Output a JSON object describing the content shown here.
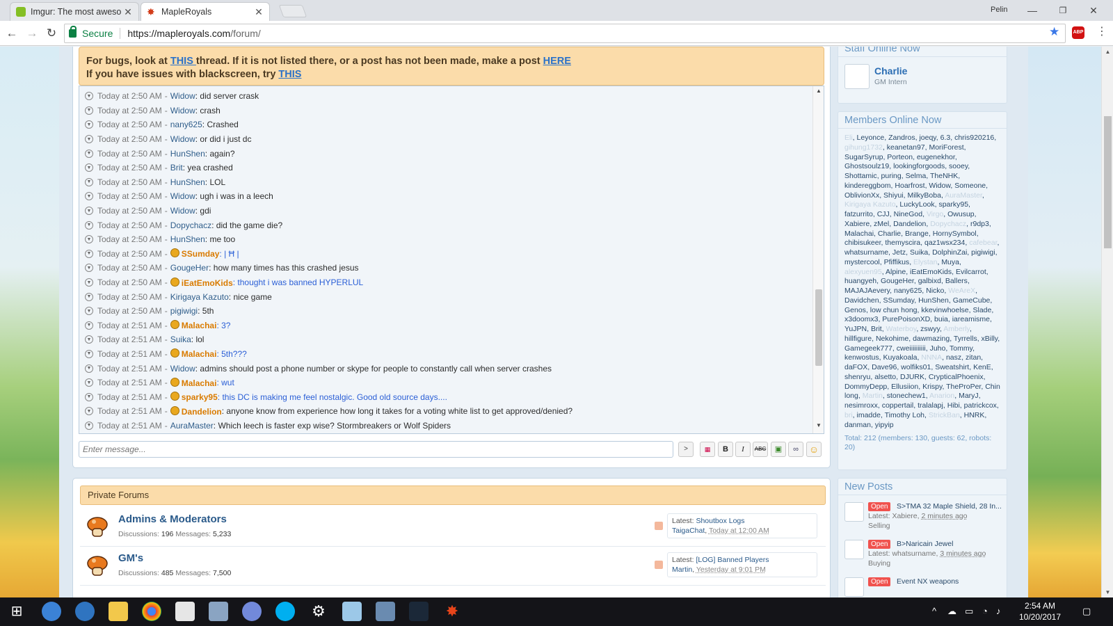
{
  "browser": {
    "tabs": [
      {
        "title": "Imgur: The most aweso",
        "active": false
      },
      {
        "title": "MapleRoyals",
        "active": true
      }
    ],
    "profile_name": "Pelin",
    "secure_label": "Secure",
    "url_host": "https://mapleroyals.com",
    "url_path": "/forum/",
    "abp_label": "ABP"
  },
  "notice": {
    "line1_prefix": "For bugs, look at ",
    "line1_link1": "THIS ",
    "line1_middle": "thread. If it is not listed there, or a post has not been made, make a post ",
    "line1_link2": "HERE",
    "line2_prefix": "If you have issues with blackscreen, try ",
    "line2_link": "THIS"
  },
  "shoutbox": {
    "messages": [
      {
        "time": "Today at 2:50 AM",
        "user": "Widow",
        "text": "did server crask",
        "staff": false,
        "blue": false
      },
      {
        "time": "Today at 2:50 AM",
        "user": "Widow",
        "text": "crash",
        "staff": false,
        "blue": false
      },
      {
        "time": "Today at 2:50 AM",
        "user": "nany625",
        "text": "Crashed",
        "staff": false,
        "blue": false
      },
      {
        "time": "Today at 2:50 AM",
        "user": "Widow",
        "text": "or did i just dc",
        "staff": false,
        "blue": false
      },
      {
        "time": "Today at 2:50 AM",
        "user": "HunShen",
        "text": "again?",
        "staff": false,
        "blue": false
      },
      {
        "time": "Today at 2:50 AM",
        "user": "Brit",
        "text": "yea crashed",
        "staff": false,
        "blue": false
      },
      {
        "time": "Today at 2:50 AM",
        "user": "HunShen",
        "text": "LOL",
        "staff": false,
        "blue": false
      },
      {
        "time": "Today at 2:50 AM",
        "user": "Widow",
        "text": "ugh i was in a leech",
        "staff": false,
        "blue": false
      },
      {
        "time": "Today at 2:50 AM",
        "user": "Widow",
        "text": "gdi",
        "staff": false,
        "blue": false
      },
      {
        "time": "Today at 2:50 AM",
        "user": "Dopychacz",
        "text": "did the game die?",
        "staff": false,
        "blue": false
      },
      {
        "time": "Today at 2:50 AM",
        "user": "HunShen",
        "text": "me too",
        "staff": false,
        "blue": false
      },
      {
        "time": "Today at 2:50 AM",
        "user": "SSumday",
        "text": "| Ħ |",
        "staff": true,
        "blue": true
      },
      {
        "time": "Today at 2:50 AM",
        "user": "GougeHer",
        "text": "how many times has this crashed jesus",
        "staff": false,
        "blue": false
      },
      {
        "time": "Today at 2:50 AM",
        "user": "iEatEmoKids",
        "text": "thought i was banned HYPERLUL",
        "staff": true,
        "blue": true
      },
      {
        "time": "Today at 2:50 AM",
        "user": "Kirigaya Kazuto",
        "text": "nice game",
        "staff": false,
        "blue": false
      },
      {
        "time": "Today at 2:50 AM",
        "user": "pigiwigi",
        "text": "5th",
        "staff": false,
        "blue": false
      },
      {
        "time": "Today at 2:51 AM",
        "user": "Malachai",
        "text": "3?",
        "staff": true,
        "blue": true
      },
      {
        "time": "Today at 2:51 AM",
        "user": "Suika",
        "text": "lol",
        "staff": false,
        "blue": false
      },
      {
        "time": "Today at 2:51 AM",
        "user": "Malachai",
        "text": "5th???",
        "staff": true,
        "blue": true
      },
      {
        "time": "Today at 2:51 AM",
        "user": "Widow",
        "text": "admins should post a phone number or skype for people to constantly call when server crashes",
        "staff": false,
        "blue": false
      },
      {
        "time": "Today at 2:51 AM",
        "user": "Malachai",
        "text": "wut",
        "staff": true,
        "blue": true
      },
      {
        "time": "Today at 2:51 AM",
        "user": "sparky95",
        "text": "this DC is making me feel nostalgic. Good old source days....",
        "staff": true,
        "blue": true
      },
      {
        "time": "Today at 2:51 AM",
        "user": "Dandelion",
        "text": "anyone know from experience how long it takes for a voting white list to get approved/denied?",
        "staff": true,
        "blue": false
      },
      {
        "time": "Today at 2:51 AM",
        "user": "AuraMaster",
        "text": "Which leech is faster exp wise? Stormbreakers or Wolf Spiders",
        "staff": false,
        "blue": false
      }
    ],
    "input_placeholder": "Enter message...",
    "send_label": ">",
    "format_buttons": [
      "B",
      "I",
      "ABC"
    ]
  },
  "private_forums": {
    "heading": "Private Forums",
    "forums": [
      {
        "title": "Admins & Moderators",
        "discussions_label": "Discussions:",
        "discussions": "196",
        "messages_label": "Messages:",
        "messages": "5,233",
        "latest_label": "Latest:",
        "latest_title": "Shoutbox Logs",
        "latest_user": "TaigaChat",
        "latest_time": "Today at 12:00 AM"
      },
      {
        "title": "GM's",
        "discussions_label": "Discussions:",
        "discussions": "485",
        "messages_label": "Messages:",
        "messages": "7,500",
        "latest_label": "Latest:",
        "latest_title": "[LOG] Banned Players",
        "latest_user": "Martin",
        "latest_time": "Yesterday at 9:01 PM"
      }
    ]
  },
  "sidebar": {
    "staff_title": "Staff Online Now",
    "staff_name": "Charlie",
    "staff_role": "GM Intern",
    "members_title": "Members Online Now",
    "members": [
      {
        "n": "Eli",
        "d": true
      },
      {
        "n": "Leyonce",
        "d": false
      },
      {
        "n": "Zandros",
        "d": false
      },
      {
        "n": "joeqy",
        "d": false
      },
      {
        "n": "6.3",
        "d": false
      },
      {
        "n": "chris920216",
        "d": false
      },
      {
        "n": "gihung1732",
        "d": true
      },
      {
        "n": "keanetan97",
        "d": false
      },
      {
        "n": "MoriForest",
        "d": false
      },
      {
        "n": "SugarSyrup",
        "d": false
      },
      {
        "n": "Porteon",
        "d": false
      },
      {
        "n": "eugenekhor",
        "d": false
      },
      {
        "n": "Ghostsoulz19",
        "d": false
      },
      {
        "n": "lookingforgoods",
        "d": false
      },
      {
        "n": "sooey",
        "d": false
      },
      {
        "n": "Shottamic",
        "d": false
      },
      {
        "n": "puring",
        "d": false
      },
      {
        "n": "Selma",
        "d": false
      },
      {
        "n": "TheNHK",
        "d": false
      },
      {
        "n": "kindereggbom",
        "d": false
      },
      {
        "n": "Hoarfrost",
        "d": false
      },
      {
        "n": "Widow",
        "d": false
      },
      {
        "n": "Someone",
        "d": false
      },
      {
        "n": "OblivionXx",
        "d": false
      },
      {
        "n": "Shiyui",
        "d": false
      },
      {
        "n": "MilkyBoba",
        "d": false
      },
      {
        "n": "AuraMaster",
        "d": true
      },
      {
        "n": "Kirigaya Kazuto",
        "d": true
      },
      {
        "n": "LuckyLook",
        "d": false
      },
      {
        "n": "sparky95",
        "d": false
      },
      {
        "n": "fatzurrito",
        "d": false
      },
      {
        "n": "CJJ",
        "d": false
      },
      {
        "n": "NineGod",
        "d": false
      },
      {
        "n": "Virgo",
        "d": true
      },
      {
        "n": "Owusup",
        "d": false
      },
      {
        "n": "Xabiere",
        "d": false
      },
      {
        "n": "zMel",
        "d": false
      },
      {
        "n": "Dandelion",
        "d": false
      },
      {
        "n": "Dopychacz",
        "d": true
      },
      {
        "n": "r9dp3",
        "d": false
      },
      {
        "n": "Malachai",
        "d": false
      },
      {
        "n": "Charlie",
        "d": false
      },
      {
        "n": "Brange",
        "d": false
      },
      {
        "n": "HornySymbol",
        "d": false
      },
      {
        "n": "chibisukeer",
        "d": false
      },
      {
        "n": "themyscira",
        "d": false
      },
      {
        "n": "qaz1wsx234",
        "d": false
      },
      {
        "n": "cafebear",
        "d": true
      },
      {
        "n": "whatsurname",
        "d": false
      },
      {
        "n": "Jetz",
        "d": false
      },
      {
        "n": "Suika",
        "d": false
      },
      {
        "n": "DolphinZai",
        "d": false
      },
      {
        "n": "pigiwigi",
        "d": false
      },
      {
        "n": "mystercool",
        "d": false
      },
      {
        "n": "Pfiffikus",
        "d": false
      },
      {
        "n": "Elystan",
        "d": true
      },
      {
        "n": "Muya",
        "d": false
      },
      {
        "n": "alexyuen95",
        "d": true
      },
      {
        "n": "Alpine",
        "d": false
      },
      {
        "n": "iEatEmoKids",
        "d": false
      },
      {
        "n": "Evilcarrot",
        "d": false
      },
      {
        "n": "huangyeh",
        "d": false
      },
      {
        "n": "GougeHer",
        "d": false
      },
      {
        "n": "galbixd",
        "d": false
      },
      {
        "n": "Ballers",
        "d": false
      },
      {
        "n": "MAJAJAevery",
        "d": false
      },
      {
        "n": "nany625",
        "d": false
      },
      {
        "n": "Nicko",
        "d": false
      },
      {
        "n": "WeAreX",
        "d": true
      },
      {
        "n": "Davidchen",
        "d": false
      },
      {
        "n": "SSumday",
        "d": false
      },
      {
        "n": "HunShen",
        "d": false
      },
      {
        "n": "GameCube",
        "d": false
      },
      {
        "n": "Genos",
        "d": false
      },
      {
        "n": "low chun hong",
        "d": false
      },
      {
        "n": "kkevinwhoelse",
        "d": false
      },
      {
        "n": "Slade",
        "d": false
      },
      {
        "n": "x3doomx3",
        "d": false
      },
      {
        "n": "PurePoisonXD",
        "d": false
      },
      {
        "n": "buia",
        "d": false
      },
      {
        "n": "iareamisme",
        "d": false
      },
      {
        "n": "YuJPN",
        "d": false
      },
      {
        "n": "Brit",
        "d": false
      },
      {
        "n": "Waterboy",
        "d": true
      },
      {
        "n": "zswyy",
        "d": false
      },
      {
        "n": "Amberly",
        "d": true
      },
      {
        "n": "hillfigure",
        "d": false
      },
      {
        "n": "Nekohime",
        "d": false
      },
      {
        "n": "dawmazing",
        "d": false
      },
      {
        "n": "Tyrrells",
        "d": false
      },
      {
        "n": "xBilly",
        "d": false
      },
      {
        "n": "Gamegeek777",
        "d": false
      },
      {
        "n": "cweiiiiiiiiii",
        "d": false
      },
      {
        "n": "Juho",
        "d": false
      },
      {
        "n": "Tommy",
        "d": false
      },
      {
        "n": "kenwostus",
        "d": false
      },
      {
        "n": "Kuyakoala",
        "d": false
      },
      {
        "n": "NNNA",
        "d": true
      },
      {
        "n": "nasz",
        "d": false
      },
      {
        "n": "zitan",
        "d": false
      },
      {
        "n": "daFOX",
        "d": false
      },
      {
        "n": "Dave96",
        "d": false
      },
      {
        "n": "wolfiks01",
        "d": false
      },
      {
        "n": "Sweatshirt",
        "d": false
      },
      {
        "n": "KenE",
        "d": false
      },
      {
        "n": "shenryu",
        "d": false
      },
      {
        "n": "alsetto",
        "d": false
      },
      {
        "n": "DJURK",
        "d": false
      },
      {
        "n": "CrypticalPhoenix",
        "d": false
      },
      {
        "n": "DommyDepp",
        "d": false
      },
      {
        "n": "Ellusiion",
        "d": false
      },
      {
        "n": "Krispy",
        "d": false
      },
      {
        "n": "TheProPer",
        "d": false
      },
      {
        "n": "Chin long",
        "d": false
      },
      {
        "n": "Martin",
        "d": true
      },
      {
        "n": "stonechew1",
        "d": false
      },
      {
        "n": "Anarion",
        "d": true
      },
      {
        "n": "MaryJ",
        "d": false
      },
      {
        "n": "nesimroxx",
        "d": false
      },
      {
        "n": "coppertail",
        "d": false
      },
      {
        "n": "tralalapj",
        "d": false
      },
      {
        "n": "Hibi",
        "d": false
      },
      {
        "n": "patrickcox",
        "d": false
      },
      {
        "n": "bri",
        "d": true
      },
      {
        "n": "imadde",
        "d": false
      },
      {
        "n": "Timothy Loh",
        "d": false
      },
      {
        "n": "StrickBan",
        "d": true
      },
      {
        "n": "HNRK",
        "d": false
      },
      {
        "n": "danman",
        "d": false
      },
      {
        "n": "yipyip",
        "d": false
      }
    ],
    "members_total": "Total: 212 (members: 130, guests: 62, robots: 20)",
    "newposts_title": "New Posts",
    "new_posts": [
      {
        "badge": "Open",
        "title": "S>TMA 32 Maple Shield, 28 In...",
        "latest_label": "Latest:",
        "user": "Xabiere",
        "time": "2 minutes ago",
        "tag": "Selling"
      },
      {
        "badge": "Open",
        "title": "B>Naricain Jewel",
        "latest_label": "Latest:",
        "user": "whatsurname",
        "time": "3 minutes ago",
        "tag": "Buying"
      },
      {
        "badge": "Open",
        "title": "Event NX weapons",
        "latest_label": "",
        "user": "",
        "time": "",
        "tag": ""
      }
    ]
  },
  "taskbar": {
    "time": "2:54 AM",
    "date": "10/20/2017"
  },
  "colors": {
    "notice_bg": "#fbdcaa",
    "link_blue": "#2b72c8",
    "staff_orange": "#d97b00",
    "sidebar_title": "#6a98c4",
    "badge_red": "#f0524e"
  }
}
